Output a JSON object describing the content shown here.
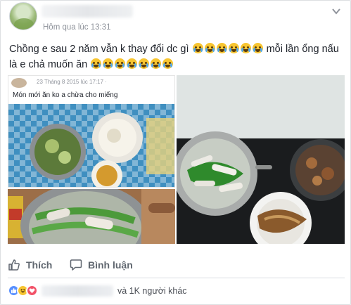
{
  "post": {
    "timestamp": "Hôm qua lúc 13:31",
    "text_line1_prefix": "Chồng e sau 2 năm vẫn k thay đổi dc gì",
    "text_line1_suffix": "mỗi lần ổng nấu",
    "text_line2_prefix": "là e chả muốn ăn",
    "emoji_icon": "crying-face-icon"
  },
  "photos": {
    "inner_post_date": "23 Tháng 8 2015 lúc 17:17 ·",
    "inner_post_caption": "Món mới ăn ko a chừa cho miếng"
  },
  "actions": {
    "like_label": "Thích",
    "comment_label": "Bình luận"
  },
  "reactions": {
    "others_text": "và 1K người khác"
  },
  "colors": {
    "like_blue": "#5890ff",
    "haha_yellow": "#f7c531",
    "love_red": "#f25268",
    "meta_gray": "#90949c"
  }
}
